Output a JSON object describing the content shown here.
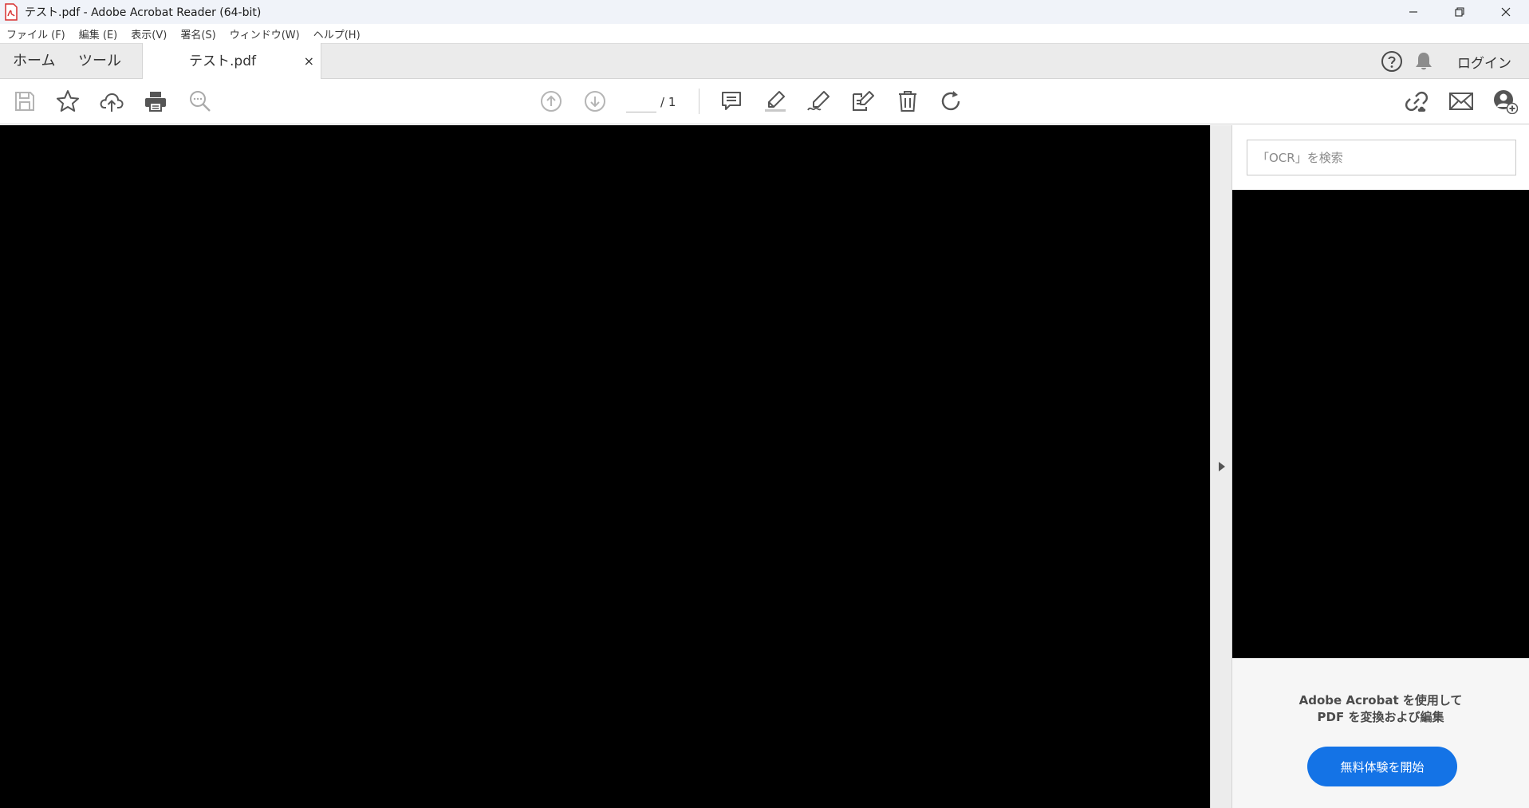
{
  "window": {
    "title": "テスト.pdf - Adobe Acrobat Reader (64-bit)"
  },
  "menu": {
    "items": [
      "ファイル (F)",
      "編集 (E)",
      "表示(V)",
      "署名(S)",
      "ウィンドウ(W)",
      "ヘルプ(H)"
    ]
  },
  "tabs": {
    "home": "ホーム",
    "tools": "ツール",
    "document": "テスト.pdf",
    "close": "×"
  },
  "header": {
    "login": "ログイン"
  },
  "toolbar": {
    "page_current": "",
    "page_total": "/ 1",
    "icons": [
      "save-icon",
      "bookmark-star-icon",
      "cloud-upload-icon",
      "print-icon",
      "zoom-search-icon",
      "page-up-icon",
      "page-down-icon",
      "comment-icon",
      "highlight-icon",
      "fill-sign-icon",
      "edit-pdf-icon",
      "delete-icon",
      "rotate-icon",
      "share-link-icon",
      "email-icon",
      "add-user-icon"
    ]
  },
  "right_pane": {
    "search_placeholder": "「OCR」を検索",
    "promo_line1": "Adobe Acrobat を使用して",
    "promo_line2": "PDF を変換および編集",
    "trial_button": "無料体験を開始"
  },
  "colors": {
    "accent": "#1473e6",
    "pdf_red": "#d72f2f",
    "icon_gray": "#6e6e6e"
  }
}
